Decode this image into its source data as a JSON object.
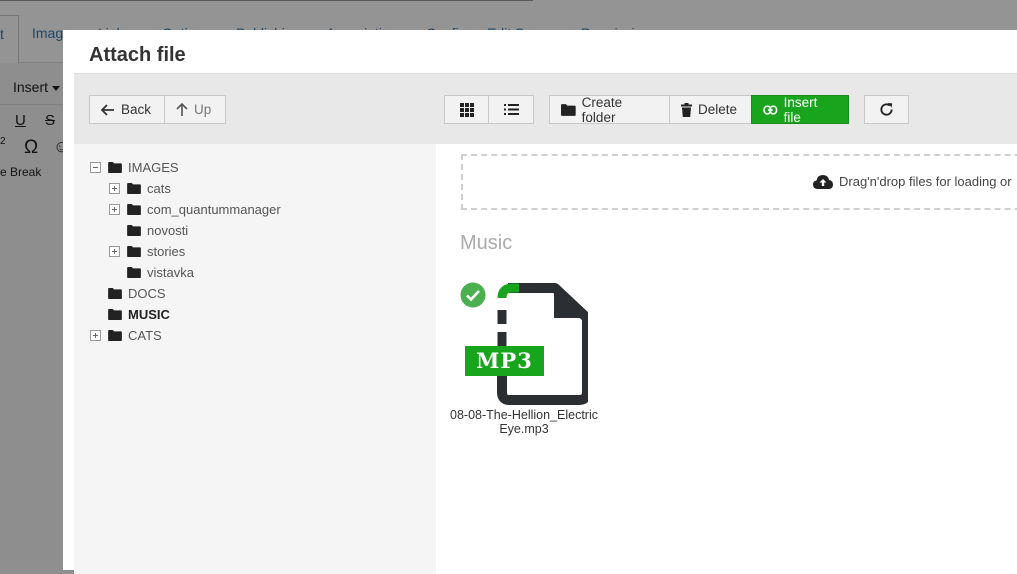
{
  "background_editor": {
    "tabs": [
      "t",
      "Image",
      "Links",
      "Options",
      "Publishing",
      "Associations",
      "Configure",
      "Edit Screen",
      "Permissions"
    ],
    "insert_label": "Insert",
    "underline": "U",
    "strike": "S",
    "superscript": "2",
    "omega": "Ω",
    "emoji": "☺",
    "page_break": "e Break"
  },
  "modal": {
    "title": "Attach file",
    "toolbar": {
      "back": "Back",
      "up": "Up",
      "create_folder": "Create folder",
      "delete": "Delete",
      "insert_file": "Insert file"
    },
    "tree": [
      {
        "label": "IMAGES",
        "level": 0,
        "expander": "minus",
        "bold": false
      },
      {
        "label": "cats",
        "level": 1,
        "expander": "plus",
        "bold": false
      },
      {
        "label": "com_quantummanager",
        "level": 1,
        "expander": "plus",
        "bold": false
      },
      {
        "label": "novosti",
        "level": 1,
        "expander": "none",
        "bold": false
      },
      {
        "label": "stories",
        "level": 1,
        "expander": "plus",
        "bold": false
      },
      {
        "label": "vistavka",
        "level": 1,
        "expander": "none",
        "bold": false
      },
      {
        "label": "DOCS",
        "level": 0,
        "expander": "none",
        "bold": false
      },
      {
        "label": "MUSIC",
        "level": 0,
        "expander": "none",
        "bold": true
      },
      {
        "label": "CATS",
        "level": 0,
        "expander": "plus",
        "bold": false
      }
    ],
    "dropzone_text": "Drag'n'drop files for loading or",
    "section_title": "Music",
    "files": [
      {
        "name": "08-08-The-Hellion_Electric Eye.mp3",
        "type_label": "MP3",
        "selected": true
      }
    ]
  },
  "colors": {
    "accent_green": "#19a41d",
    "icon_dark": "#2b2f33"
  }
}
